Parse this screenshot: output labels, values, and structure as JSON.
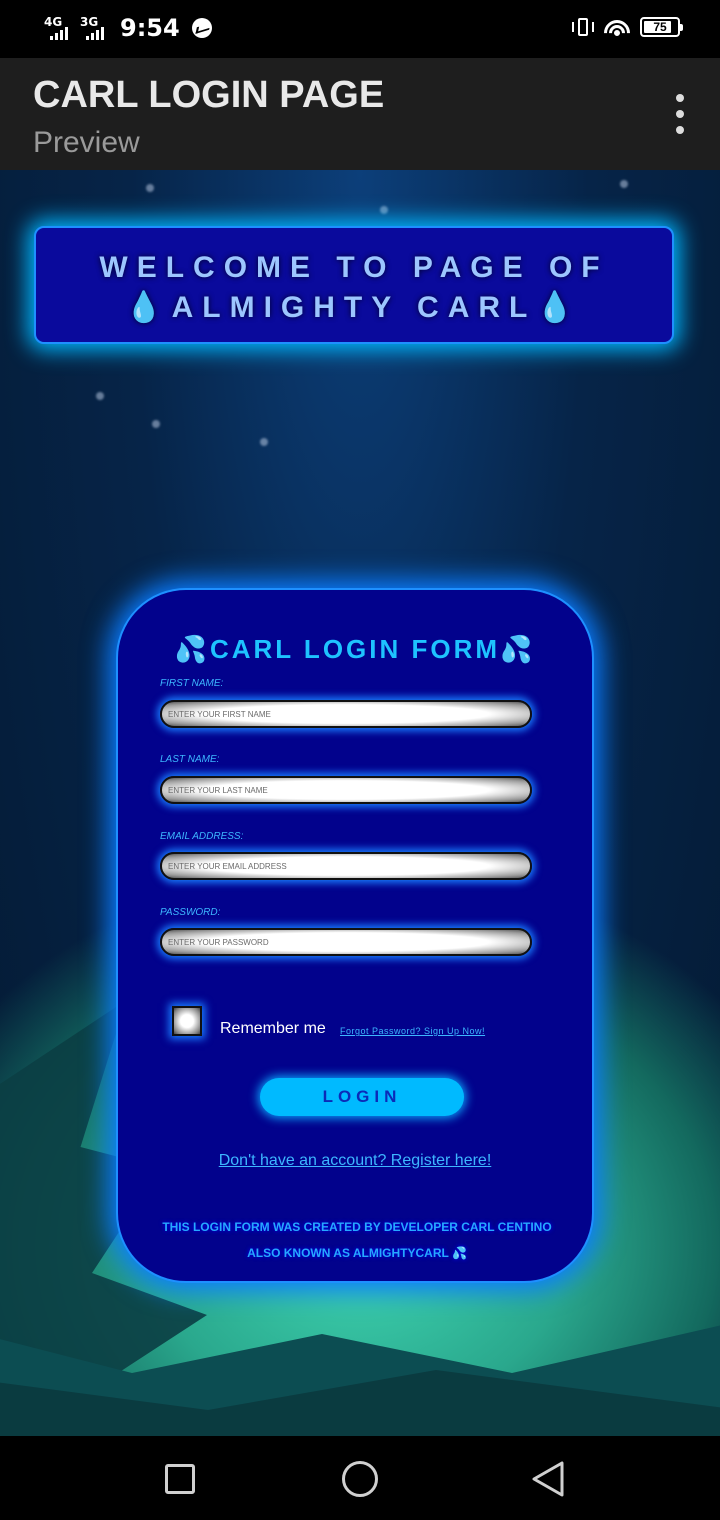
{
  "status_bar": {
    "net1": "4G",
    "net2": "3G",
    "time": "9:54",
    "battery": "75",
    "icons": [
      "messenger-icon",
      "vibrate-icon",
      "wifi-icon",
      "battery-icon"
    ]
  },
  "app_bar": {
    "title": "CARL LOGIN PAGE",
    "subtitle": "Preview"
  },
  "welcome": {
    "line1": "WELCOME TO PAGE OF",
    "line2": "💧ALMIGHTY CARL💧"
  },
  "form": {
    "title": "💦CARL LOGIN FORM💦",
    "first_name": {
      "label": "FIRST NAME:",
      "placeholder": "ENTER YOUR FIRST NAME"
    },
    "last_name": {
      "label": "LAST NAME:",
      "placeholder": "ENTER YOUR LAST NAME"
    },
    "email": {
      "label": "EMAIL ADDRESS:",
      "placeholder": "ENTER YOUR EMAIL ADDRESS"
    },
    "password": {
      "label": "PASSWORD:",
      "placeholder": "ENTER YOUR PASSWORD"
    },
    "remember": "Remember me",
    "forgot": "Forgot Password? Sign Up Now!",
    "login": "LOGIN",
    "register": "Don't have an account? Register here!",
    "credit1": "THIS LOGIN FORM WAS CREATED BY DEVELOPER CARL CENTINO",
    "credit2": "ALSO KNOWN AS ALMIGHTYCARL 💦"
  },
  "colors": {
    "card_bg": "#02028c",
    "glow": "#0b7cff",
    "accent": "#00baff"
  }
}
